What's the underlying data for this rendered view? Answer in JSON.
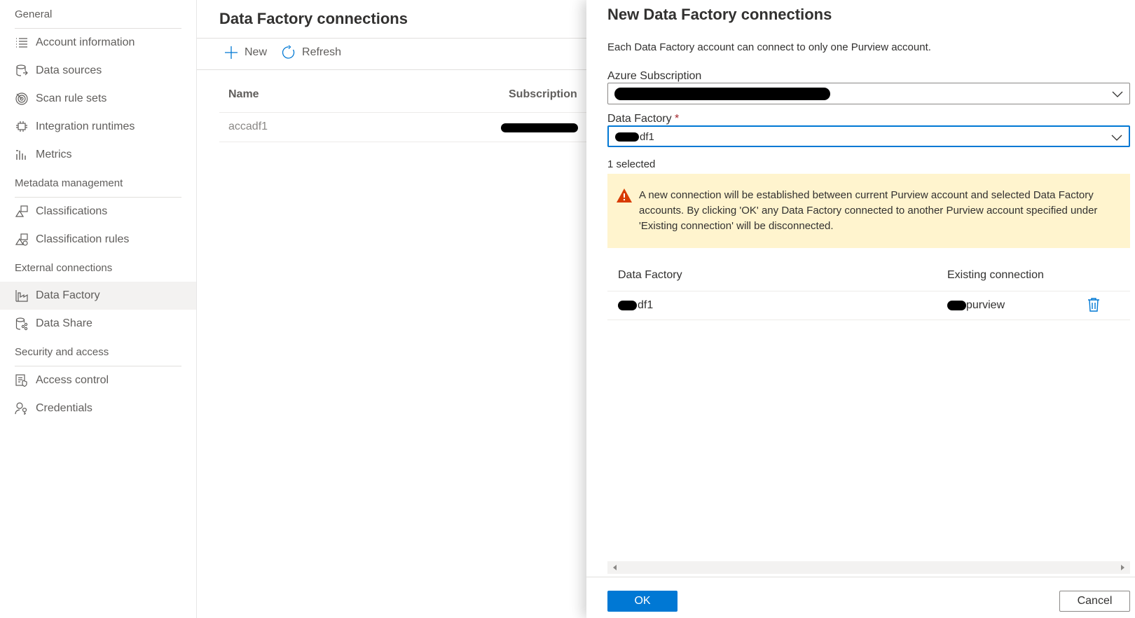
{
  "sidebar": {
    "sections": [
      {
        "title": "General",
        "items": [
          {
            "label": "Account information",
            "icon": "list-icon"
          },
          {
            "label": "Data sources",
            "icon": "database-icon"
          },
          {
            "label": "Scan rule sets",
            "icon": "radar-icon"
          },
          {
            "label": "Integration runtimes",
            "icon": "runtime-icon"
          },
          {
            "label": "Metrics",
            "icon": "bar-chart-icon"
          }
        ]
      },
      {
        "title": "Metadata management",
        "items": [
          {
            "label": "Classifications",
            "icon": "classification-icon"
          },
          {
            "label": "Classification rules",
            "icon": "classification-rules-icon"
          }
        ]
      },
      {
        "title": "External connections",
        "items": [
          {
            "label": "Data Factory",
            "icon": "data-factory-icon",
            "active": true
          },
          {
            "label": "Data Share",
            "icon": "data-share-icon"
          }
        ]
      },
      {
        "title": "Security and access",
        "items": [
          {
            "label": "Access control",
            "icon": "access-control-icon"
          },
          {
            "label": "Credentials",
            "icon": "credentials-icon"
          }
        ]
      }
    ]
  },
  "main": {
    "title": "Data Factory connections",
    "toolbar": {
      "new_label": "New",
      "refresh_label": "Refresh"
    },
    "table": {
      "columns": [
        "Name",
        "Subscription"
      ],
      "rows": [
        {
          "name": "accadf1",
          "subscription": ""
        }
      ]
    }
  },
  "panel": {
    "title": "New Data Factory connections",
    "description": "Each Data Factory account can connect to only one Purview account.",
    "subscription": {
      "label": "Azure Subscription",
      "value": ""
    },
    "data_factory": {
      "label": "Data Factory",
      "required_mark": "*",
      "value": "df1"
    },
    "selected_count": "1 selected",
    "warning": "A new connection will be established between current Purview account and selected Data Factory accounts. By clicking 'OK' any Data Factory connected to another Purview account specified under 'Existing connection' will be disconnected.",
    "table": {
      "columns": [
        "Data Factory",
        "Existing connection"
      ],
      "rows": [
        {
          "data_factory": "df1",
          "existing_connection": "purview"
        }
      ]
    },
    "ok_label": "OK",
    "cancel_label": "Cancel"
  },
  "colors": {
    "accent": "#0078d4",
    "warning_bg": "#fff4ce",
    "warning_icon": "#d83b01"
  }
}
